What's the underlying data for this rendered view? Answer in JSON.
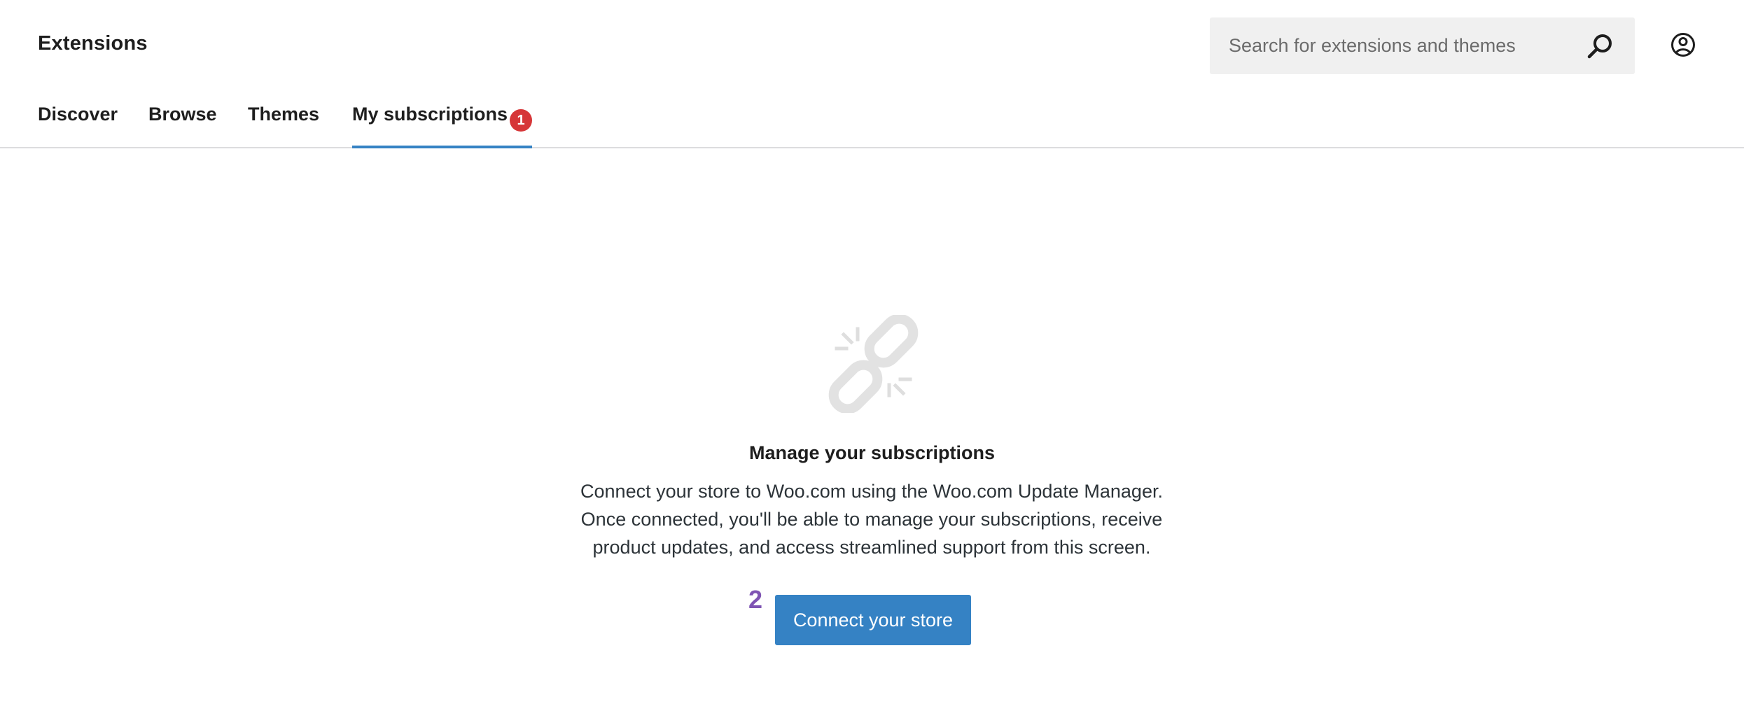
{
  "header": {
    "title": "Extensions",
    "search": {
      "placeholder": "Search for extensions and themes",
      "value": "",
      "icon": "search-icon"
    },
    "account_icon": "user-account-icon"
  },
  "tabs": [
    {
      "label": "Discover",
      "active": false
    },
    {
      "label": "Browse",
      "active": false
    },
    {
      "label": "Themes",
      "active": false
    },
    {
      "label": "My subscriptions",
      "active": true,
      "badge": "1"
    }
  ],
  "empty_state": {
    "icon": "broken-link-icon",
    "heading": "Manage your subscriptions",
    "body_lines": [
      "Connect your store to Woo.com using the Woo.com Update Manager.",
      "Once connected, you'll be able to manage your subscriptions, receive",
      "product updates, and access streamlined support from this screen."
    ],
    "step_number": "2",
    "button_label": "Connect your store"
  },
  "colors": {
    "accent": "#3582c4",
    "badge": "#d63638",
    "step_number": "#7f54b3",
    "icon_gray": "#e0e0e0",
    "divider": "#dcdcde"
  }
}
